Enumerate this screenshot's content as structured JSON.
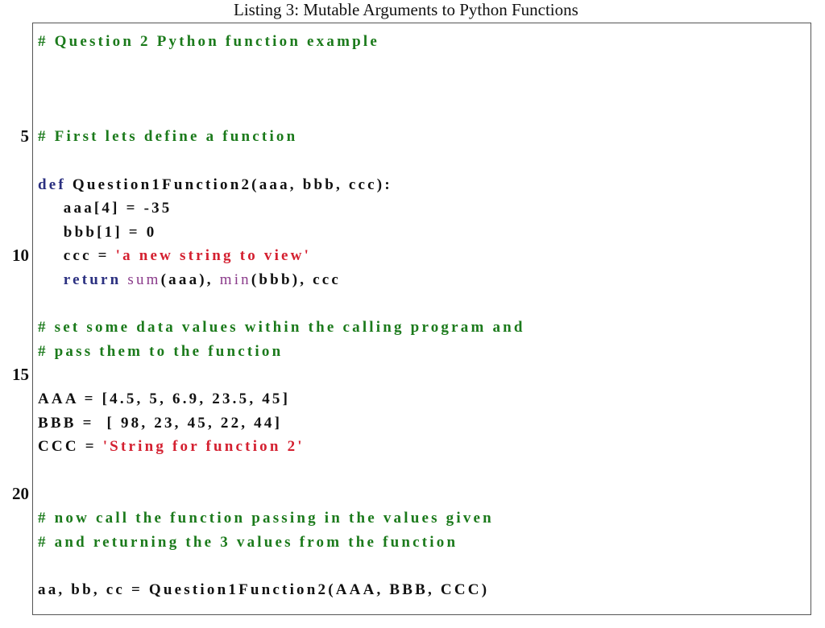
{
  "caption": "Listing 3: Mutable Arguments to Python Functions",
  "colors": {
    "comment": "#1b7a1b",
    "keyword": "#2b3080",
    "builtin": "#8a3a8a",
    "string": "#d42030",
    "text": "#111111",
    "border": "#555555"
  },
  "line_numbers": [
    "5",
    "10",
    "15",
    "20"
  ],
  "lines": [
    {
      "n": 1,
      "tokens": [
        {
          "t": "cm",
          "v": "# Question 2 Python function example"
        }
      ]
    },
    {
      "n": 2,
      "tokens": []
    },
    {
      "n": 3,
      "tokens": []
    },
    {
      "n": 4,
      "tokens": []
    },
    {
      "n": 5,
      "tokens": [
        {
          "t": "cm",
          "v": "# First lets define a function"
        }
      ]
    },
    {
      "n": 6,
      "tokens": []
    },
    {
      "n": 7,
      "tokens": [
        {
          "t": "kw",
          "v": "def"
        },
        {
          "t": "plain",
          "v": " Question1Function2(aaa, bbb, ccc):"
        }
      ]
    },
    {
      "n": 8,
      "tokens": [
        {
          "t": "plain",
          "v": "    aaa[4] = -35"
        }
      ]
    },
    {
      "n": 9,
      "tokens": [
        {
          "t": "plain",
          "v": "    bbb[1] = 0"
        }
      ]
    },
    {
      "n": 10,
      "tokens": [
        {
          "t": "plain",
          "v": "    ccc = "
        },
        {
          "t": "st",
          "v": "'a new string to view'"
        }
      ]
    },
    {
      "n": 11,
      "tokens": [
        {
          "t": "kw",
          "v": "    return"
        },
        {
          "t": "plain",
          "v": " "
        },
        {
          "t": "bi",
          "v": "sum"
        },
        {
          "t": "plain",
          "v": "(aaa), "
        },
        {
          "t": "bi",
          "v": "min"
        },
        {
          "t": "plain",
          "v": "(bbb), ccc"
        }
      ]
    },
    {
      "n": 12,
      "tokens": []
    },
    {
      "n": 13,
      "tokens": [
        {
          "t": "cm",
          "v": "# set some data values within the calling program and"
        }
      ]
    },
    {
      "n": 14,
      "tokens": [
        {
          "t": "cm",
          "v": "# pass them to the function"
        }
      ]
    },
    {
      "n": 15,
      "tokens": []
    },
    {
      "n": 16,
      "tokens": [
        {
          "t": "plain",
          "v": "AAA = [4.5, 5, 6.9, 23.5, 45]"
        }
      ]
    },
    {
      "n": 17,
      "tokens": [
        {
          "t": "plain",
          "v": "BBB =  [ 98, 23, 45, 22, 44]"
        }
      ]
    },
    {
      "n": 18,
      "tokens": [
        {
          "t": "plain",
          "v": "CCC = "
        },
        {
          "t": "st",
          "v": "'String for function 2'"
        }
      ]
    },
    {
      "n": 19,
      "tokens": []
    },
    {
      "n": 20,
      "tokens": []
    },
    {
      "n": 21,
      "tokens": [
        {
          "t": "cm",
          "v": "# now call the function passing in the values given"
        }
      ]
    },
    {
      "n": 22,
      "tokens": [
        {
          "t": "cm",
          "v": "# and returning the 3 values from the function"
        }
      ]
    },
    {
      "n": 23,
      "tokens": []
    },
    {
      "n": 24,
      "tokens": [
        {
          "t": "plain",
          "v": "aa, bb, cc = Question1Function2(AAA, BBB, CCC)"
        }
      ]
    }
  ]
}
